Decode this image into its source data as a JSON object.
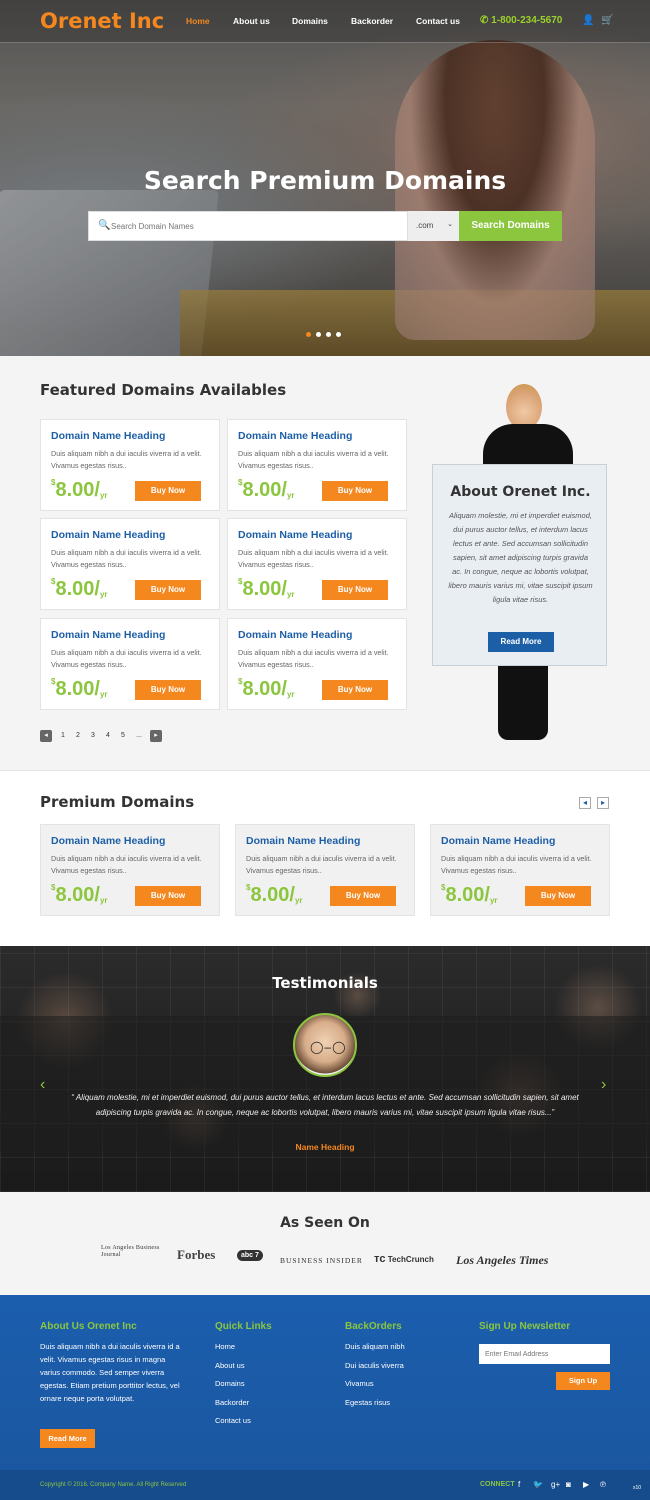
{
  "brand": {
    "logo": "Orenet Inc",
    "accent_orange": "#f5871f",
    "accent_green": "#8cc63f",
    "accent_blue": "#1d5fa7"
  },
  "nav": {
    "items": [
      "Home",
      "About us",
      "Domains",
      "Backorder",
      "Contact us"
    ],
    "phone": "1-800-234-5670",
    "icons": [
      "user-icon",
      "cart-icon"
    ]
  },
  "hero": {
    "title": "Search Premium Domains",
    "search_placeholder": "Search Domain Names",
    "tld": ".com",
    "search_button": "Search Domains",
    "slides": 4,
    "active_slide": 1
  },
  "featured": {
    "title": "Featured Domains Availables",
    "cards": [
      {
        "heading": "Domain Name Heading",
        "desc": "Duis aliquam nibh a dui iaculis viverra id a velit. Vivamus egestas risus..",
        "currency": "$",
        "price": "8.00/",
        "unit": "yr",
        "button": "Buy Now"
      },
      {
        "heading": "Domain Name Heading",
        "desc": "Duis aliquam nibh a dui iaculis viverra id a velit. Vivamus egestas risus..",
        "currency": "$",
        "price": "8.00/",
        "unit": "yr",
        "button": "Buy Now"
      },
      {
        "heading": "Domain Name Heading",
        "desc": "Duis aliquam nibh a dui iaculis viverra id a velit. Vivamus egestas risus..",
        "currency": "$",
        "price": "8.00/",
        "unit": "yr",
        "button": "Buy Now"
      },
      {
        "heading": "Domain Name Heading",
        "desc": "Duis aliquam nibh a dui iaculis viverra id a velit. Vivamus egestas risus..",
        "currency": "$",
        "price": "8.00/",
        "unit": "yr",
        "button": "Buy Now"
      },
      {
        "heading": "Domain Name Heading",
        "desc": "Duis aliquam nibh a dui iaculis viverra id a velit. Vivamus egestas risus..",
        "currency": "$",
        "price": "8.00/",
        "unit": "yr",
        "button": "Buy Now"
      },
      {
        "heading": "Domain Name Heading",
        "desc": "Duis aliquam nibh a dui iaculis viverra id a velit. Vivamus egestas risus..",
        "currency": "$",
        "price": "8.00/",
        "unit": "yr",
        "button": "Buy Now"
      }
    ],
    "pagination": {
      "pages": [
        "1",
        "2",
        "3",
        "4",
        "5"
      ],
      "ellipsis": "..."
    }
  },
  "about": {
    "title": "About Orenet Inc.",
    "text": "Aliquam molestie, mi et imperdiet euismod, dui purus auctor tellus, et interdum lacus lectus et ante. Sed accumsan sollicitudin sapien, sit amet adipiscing turpis gravida ac. In congue, neque ac lobortis volutpat, libero mauris varius mi, vitae suscipit ipsum ligula vitae risus.",
    "button": "Read More"
  },
  "premium": {
    "title": "Premium Domains",
    "cards": [
      {
        "heading": "Domain Name Heading",
        "desc": "Duis aliquam nibh a dui iaculis viverra id a velit. Vivamus egestas risus..",
        "currency": "$",
        "price": "8.00/",
        "unit": "yr",
        "button": "Buy Now"
      },
      {
        "heading": "Domain Name Heading",
        "desc": "Duis aliquam nibh a dui iaculis viverra id a velit. Vivamus egestas risus..",
        "currency": "$",
        "price": "8.00/",
        "unit": "yr",
        "button": "Buy Now"
      },
      {
        "heading": "Domain Name Heading",
        "desc": "Duis aliquam nibh a dui iaculis viverra id a velit. Vivamus egestas risus..",
        "currency": "$",
        "price": "8.00/",
        "unit": "yr",
        "button": "Buy Now"
      }
    ]
  },
  "testimonials": {
    "title": "Testimonials",
    "quote": "“ Aliquam molestie, mi et imperdiet euismod, dui purus auctor tellus, et interdum lacus lectus et ante. Sed accumsan sollicitudin sapien, sit amet adipiscing turpis gravida ac. In congue, neque ac lobortis volutpat, libero mauris varius mi, vitae suscipit ipsum ligula vitae risus...”",
    "name": "Name Heading"
  },
  "seen_on": {
    "title": "As Seen On",
    "logos": [
      "Los Angeles Business Journal",
      "Forbes",
      "abc 7",
      "Business Insider",
      "TechCrunch",
      "Los Angeles Times"
    ]
  },
  "footer": {
    "about_title": "About Us Orenet Inc",
    "about_text": "Duis aliquam nibh a dui iaculis viverra id a velit. Vivamus egestas risus in magna varius commodo. Sed semper viverra egestas. Etiam pretium porttitor lectus, vel ornare neque porta volutpat.",
    "about_button": "Read More",
    "quick_title": "Quick Links",
    "quick_links": [
      "Home",
      "About us",
      "Domains",
      "Backorder",
      "Contact us"
    ],
    "back_title": "BackOrders",
    "back_links": [
      "Duis aliquam nibh",
      "Dui iaculis viverra",
      "Vivamus",
      "Egestas risus"
    ],
    "news_title": "Sign Up Newsletter",
    "email_placeholder": "Enter Email Address",
    "signup_button": "Sign Up"
  },
  "bottom": {
    "copyright": "Copyright © 2016. Company Name. All Right Reserved",
    "connect": "CONNECT",
    "social": [
      "f",
      "t",
      "g+",
      "ig",
      "yt",
      "p"
    ],
    "badge": "x10"
  }
}
